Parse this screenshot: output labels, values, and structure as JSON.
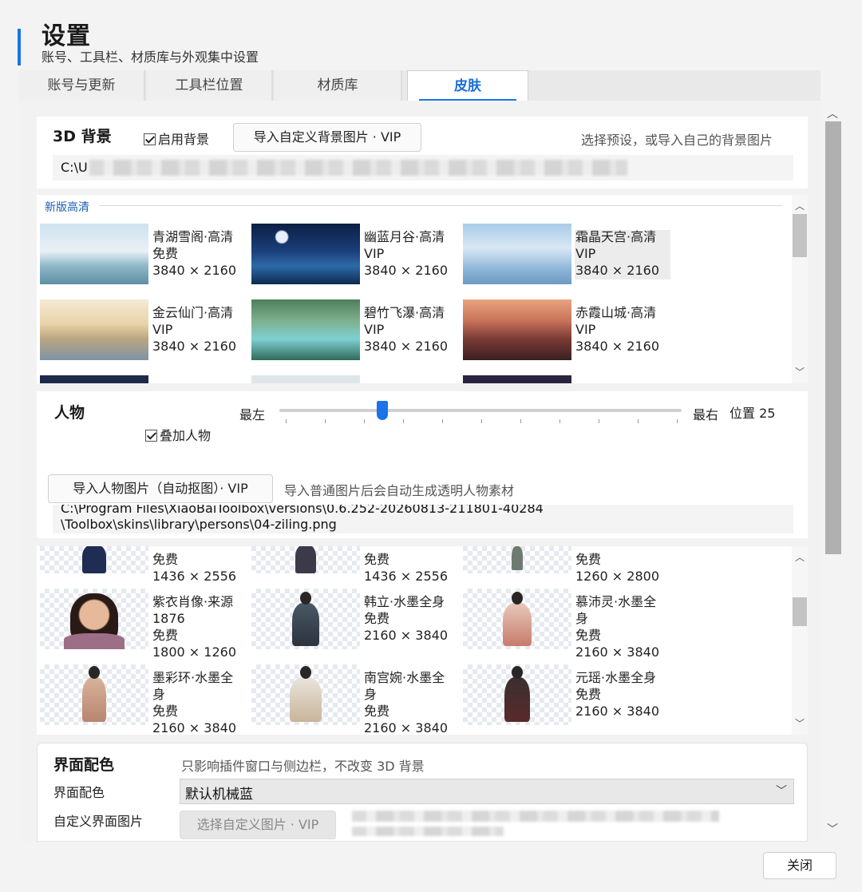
{
  "header": {
    "title": "设置",
    "subtitle": "账号、工具栏、材质库与外观集中设置"
  },
  "tabs": [
    {
      "label": "账号与更新"
    },
    {
      "label": "工具栏位置"
    },
    {
      "label": "材质库"
    },
    {
      "label": "皮肤",
      "active": true
    }
  ],
  "background_section": {
    "title": "3D 背景",
    "enable_label": "启用背景",
    "enabled": true,
    "import_button": "导入自定义背景图片 · VIP",
    "hint": "选择预设，或导入自己的背景图片",
    "path_prefix": "C:\\U"
  },
  "bg_gallery": {
    "group_label": "新版高清",
    "items": [
      {
        "name": "青湖雪阁·高清",
        "tier": "免费",
        "size": "3840 × 2160"
      },
      {
        "name": "幽蓝月谷·高清",
        "tier": "VIP",
        "size": "3840 × 2160"
      },
      {
        "name": "霜晶天宫·高清",
        "tier": "VIP",
        "size": "3840 × 2160",
        "selected": true
      },
      {
        "name": "金云仙门·高清",
        "tier": "VIP",
        "size": "3840 × 2160"
      },
      {
        "name": "碧竹飞瀑·高清",
        "tier": "VIP",
        "size": "3840 × 2160"
      },
      {
        "name": "赤霞山城·高清",
        "tier": "VIP",
        "size": "3840 × 2160"
      }
    ]
  },
  "person_section": {
    "title": "人物",
    "overlay_label": "叠加人物",
    "overlay": true,
    "slider_min_label": "最左",
    "slider_max_label": "最右",
    "position_label": "位置 25",
    "position_value": 25,
    "import_button": "导入人物图片（自动抠图）· VIP",
    "hint": "导入普通图片后会自动生成透明人物素材",
    "path_line1": "C:\\Program Files\\XiaoBaiToolbox\\versions\\0.6.252-20260813-211801-40284",
    "path_line2": "\\Toolbox\\skins\\library\\persons\\04-ziling.png"
  },
  "person_gallery": {
    "partial_row": [
      {
        "tier": "免费",
        "size": "1436 × 2556"
      },
      {
        "tier": "免费",
        "size": "1436 × 2556"
      },
      {
        "tier": "免费",
        "size": "1260 × 2800"
      }
    ],
    "items": [
      {
        "name": "紫衣肖像·来源",
        "extra": "1876",
        "tier": "免费",
        "size": "1800 × 1260"
      },
      {
        "name": "韩立·水墨全身",
        "tier": "免费",
        "size": "2160 × 3840"
      },
      {
        "name": "慕沛灵·水墨全身",
        "tier": "免费",
        "size": "2160 × 3840"
      },
      {
        "name": "墨彩环·水墨全身",
        "tier": "免费",
        "size": "2160 × 3840"
      },
      {
        "name": "南宫婉·水墨全身",
        "tier": "免费",
        "size": "2160 × 3840"
      },
      {
        "name": "元瑶·水墨全身",
        "tier": "免费",
        "size": "2160 × 3840"
      }
    ]
  },
  "theme_section": {
    "title": "界面配色",
    "hint": "只影响插件窗口与侧边栏，不改变 3D 背景",
    "color_label": "界面配色",
    "color_value": "默认机械蓝",
    "custom_image_label": "自定义界面图片",
    "custom_image_button": "选择自定义图片 · VIP"
  },
  "footer": {
    "close_label": "关闭"
  },
  "icons": {
    "check": "check-icon",
    "chevron_up": "▲",
    "chevron_down": "▼"
  },
  "colors": {
    "accent": "#1a73e8"
  }
}
